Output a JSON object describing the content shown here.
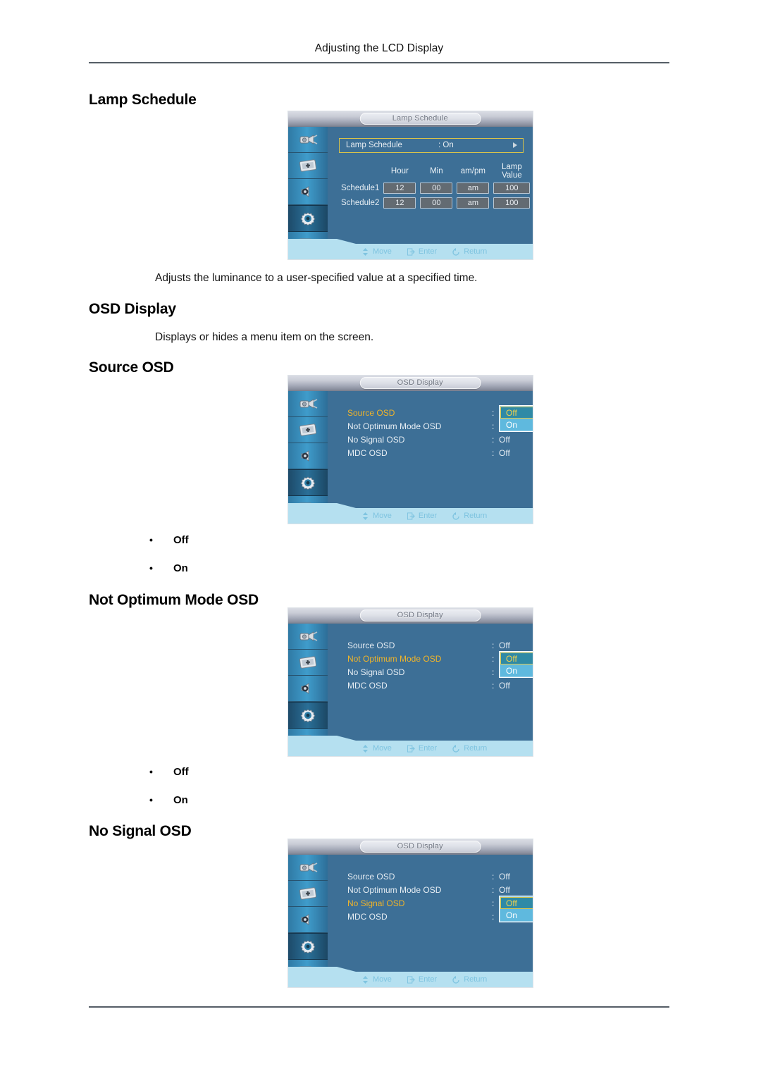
{
  "document": {
    "running_header": "Adjusting the LCD Display"
  },
  "sections": [
    {
      "heading": "Lamp Schedule",
      "description": "Adjusts the luminance to a user-specified value at a specified time."
    },
    {
      "heading": "OSD Display",
      "description": "Displays or hides a menu item on the screen."
    },
    {
      "heading": "Source OSD"
    },
    {
      "heading": "Not Optimum Mode OSD"
    },
    {
      "heading": "No Signal OSD"
    }
  ],
  "bullets": {
    "off": "Off",
    "on": "On"
  },
  "osd_common": {
    "footer": {
      "move": "Move",
      "enter": "Enter",
      "return": "Return"
    },
    "sidebar_icons": [
      "input-source-icon",
      "picture-icon",
      "sound-speaker-icon",
      "setup-gear-icon",
      "multi-control-pages-icon"
    ],
    "active_sidebar_index": 3
  },
  "osd_lamp_schedule": {
    "title": "Lamp Schedule",
    "row": {
      "label": "Lamp Schedule",
      "separator": ":",
      "value": "On"
    },
    "table": {
      "columns": [
        "Hour",
        "Min",
        "am/pm",
        "Lamp Value"
      ],
      "rows": [
        {
          "name": "Schedule1",
          "hour": "12",
          "min": "00",
          "ampm": "am",
          "lamp_value": "100"
        },
        {
          "name": "Schedule2",
          "hour": "12",
          "min": "00",
          "ampm": "am",
          "lamp_value": "100"
        }
      ]
    }
  },
  "osd_source": {
    "title": "OSD Display",
    "items": [
      {
        "label": "Source OSD",
        "value": "Off",
        "selected": true
      },
      {
        "label": "Not Optimum Mode OSD",
        "value": "On",
        "selected": false
      },
      {
        "label": "No Signal OSD",
        "value": "Off",
        "selected": false
      },
      {
        "label": "MDC OSD",
        "value": "Off",
        "selected": false
      }
    ],
    "dropdown": {
      "highlight": "Off",
      "other": "On"
    }
  },
  "osd_not_optimum": {
    "title": "OSD Display",
    "items": [
      {
        "label": "Source OSD",
        "value": "Off",
        "selected": false
      },
      {
        "label": "Not Optimum Mode OSD",
        "value": "Off",
        "selected": true
      },
      {
        "label": "No Signal OSD",
        "value": "On",
        "selected": false
      },
      {
        "label": "MDC OSD",
        "value": "Off",
        "selected": false
      }
    ],
    "dropdown": {
      "highlight": "Off",
      "other": "On"
    }
  },
  "osd_no_signal": {
    "title": "OSD Display",
    "items": [
      {
        "label": "Source OSD",
        "value": "Off",
        "selected": false
      },
      {
        "label": "Not Optimum Mode OSD",
        "value": "Off",
        "selected": false
      },
      {
        "label": "No Signal OSD",
        "value": "Off",
        "selected": true
      },
      {
        "label": "MDC OSD",
        "value": "On",
        "selected": false
      }
    ],
    "dropdown": {
      "highlight": "Off",
      "other": "On"
    }
  },
  "colors": {
    "osd_body": "#3d6f96",
    "osd_footer": "#b5e0f0",
    "highlight_yellow": "#f0b429",
    "dropdown_blue": "#9fd4ec",
    "selected_teal": "#2f8aa6"
  }
}
